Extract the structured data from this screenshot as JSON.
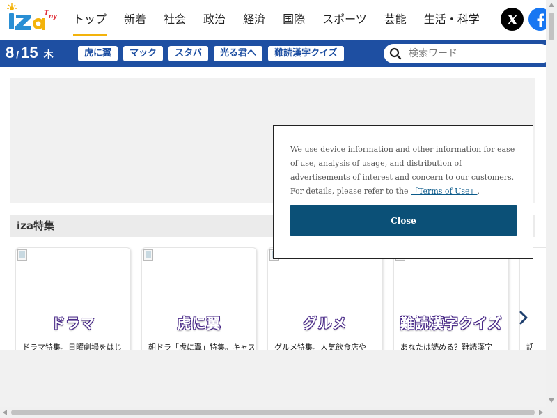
{
  "header": {
    "nav": [
      {
        "label": "トップ",
        "active": true
      },
      {
        "label": "新着"
      },
      {
        "label": "社会"
      },
      {
        "label": "政治"
      },
      {
        "label": "経済"
      },
      {
        "label": "国際"
      },
      {
        "label": "スポーツ"
      },
      {
        "label": "芸能"
      },
      {
        "label": "生活・科学"
      }
    ],
    "social": [
      "x-icon",
      "facebook-icon"
    ]
  },
  "subbar": {
    "date_md": "8",
    "date_sep": "/",
    "date_day": "15",
    "weekday": "木",
    "tags": [
      "虎に翼",
      "マック",
      "スタバ",
      "光る君へ",
      "難読漢字クイズ"
    ]
  },
  "search": {
    "placeholder": "検索ワード",
    "icon": "search-icon"
  },
  "features": {
    "title": "iza特集",
    "cards": [
      {
        "title": "ドラマ",
        "desc": "ドラマ特集。日曜劇場をはじ"
      },
      {
        "title": "虎に翼",
        "desc": "朝ドラ「虎に翼」特集。キャス"
      },
      {
        "title": "グルメ",
        "desc": "グルメ特集。人気飲食店や"
      },
      {
        "title": "難読漢字クイズ",
        "desc": "あなたは読める？難読漢字"
      },
      {
        "title": "",
        "desc": "話"
      }
    ],
    "next_icon": "chevron-right-icon"
  },
  "cookie": {
    "text": "We use device information and other information for ease of use, analysis of usage, and distribution of advertisements of interest and concern to our customers. For details, please refer to the",
    "link": "「Terms of Use」",
    "suffix": ".",
    "close": "Close"
  },
  "colors": {
    "brand_blue": "#1e4fa2",
    "nav_active": "#f3b30c",
    "close_button": "#0b5077"
  }
}
